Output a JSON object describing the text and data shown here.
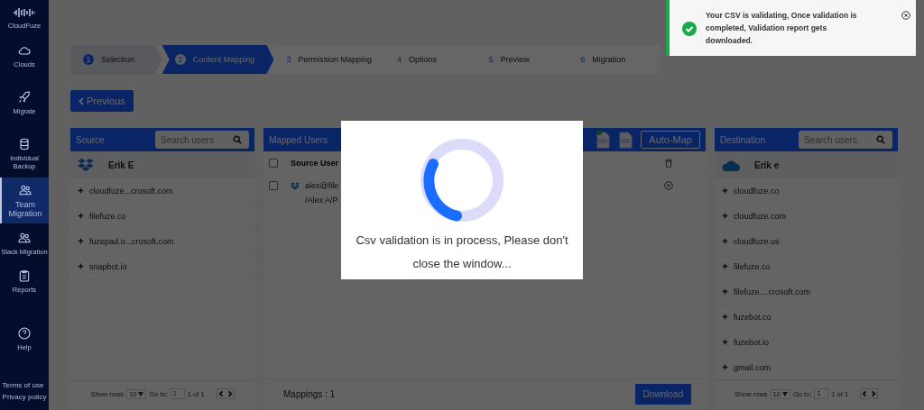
{
  "sidebar": {
    "brand": "CloudFuze",
    "items": [
      {
        "label": "Clouds",
        "selected": false
      },
      {
        "label": "Migrate",
        "selected": false
      },
      {
        "label": "Individual Backup",
        "selected": false
      },
      {
        "label": "Team Migration",
        "selected": true
      },
      {
        "label": "Slack Migration",
        "selected": false
      },
      {
        "label": "Reports",
        "selected": false
      },
      {
        "label": "Help",
        "selected": false
      }
    ],
    "links": [
      "Terms of use",
      "Privacy policy"
    ]
  },
  "toast": {
    "message": "Your CSV is validating, Once validation is completed, Validation report gets downloaded."
  },
  "steps": [
    {
      "number": "1",
      "label": "Selection",
      "completed": true,
      "selected": false
    },
    {
      "number": "2",
      "label": "Content Mapping",
      "completed": false,
      "selected": true
    },
    {
      "number": "3",
      "label": "Permission Mapping",
      "completed": false,
      "selected": false
    },
    {
      "number": "4",
      "label": "Options",
      "completed": false,
      "selected": false
    },
    {
      "number": "5",
      "label": "Preview",
      "completed": false,
      "selected": false
    },
    {
      "number": "6",
      "label": "Migration",
      "completed": false,
      "selected": false
    }
  ],
  "previous_button": "Previous",
  "source": {
    "title": "Source",
    "search_placeholder": "Search users",
    "user": "Erik E",
    "items": [
      "cloudfuze...crosoft.com",
      "filefuze.co",
      "fuzepad.o...crosoft.com",
      "snapbot.io"
    ],
    "pager": {
      "show_rows": "Show rows",
      "rows": "10",
      "go_to": "Go to:",
      "page": "1",
      "of": "1 of 1"
    }
  },
  "mapped": {
    "title": "Mapped Users",
    "auto_map": "Auto-Map",
    "header": {
      "checked": false,
      "label": "Source User"
    },
    "rows": [
      {
        "checked": false,
        "line_1": "alex@file",
        "line_2": "/Alex A/P"
      }
    ],
    "mappings": "Mappings : 1",
    "download": "Download"
  },
  "destination": {
    "title": "Destination",
    "search_placeholder": "Search users",
    "user": "Erik e",
    "items": [
      "cloudfuze.co",
      "cloudfuze.com",
      "cloudfuze.us",
      "filefuze.co",
      "filefuze....crosoft.com",
      "fuzebot.co",
      "fuzebot.io",
      "gmail.com"
    ],
    "pager": {
      "show_rows": "Show rows",
      "rows": "10",
      "go_to": "Go to:",
      "page": "1",
      "of": "1 of 1"
    }
  },
  "modal": {
    "message": "Csv validation is in process, Please don't close the window..."
  }
}
